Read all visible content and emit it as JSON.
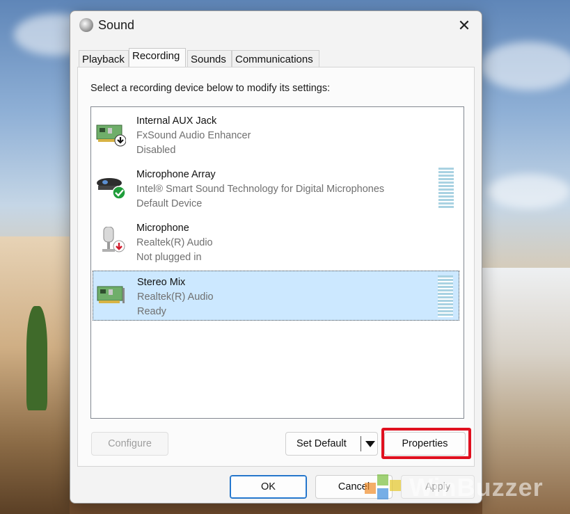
{
  "window": {
    "title": "Sound",
    "icon": "speaker-icon",
    "close_glyph": "✕"
  },
  "tabs": [
    {
      "label": "Playback"
    },
    {
      "label": "Recording",
      "active": true
    },
    {
      "label": "Sounds"
    },
    {
      "label": "Communications"
    }
  ],
  "instruction": "Select a recording device below to modify its settings:",
  "devices": [
    {
      "name": "Internal AUX Jack",
      "subtitle": "FxSound Audio Enhancer",
      "status": "Disabled",
      "icon": "sound-card-icon",
      "badge": "down-arrow-badge"
    },
    {
      "name": "Microphone Array",
      "subtitle": "Intel® Smart Sound Technology for Digital Microphones",
      "status": "Default Device",
      "icon": "webcam-microphone-icon",
      "badge": "green-check-badge"
    },
    {
      "name": "Microphone",
      "subtitle": "Realtek(R) Audio",
      "status": "Not plugged in",
      "icon": "microphone-icon",
      "badge": "red-down-arrow-badge"
    },
    {
      "name": "Stereo Mix",
      "subtitle": "Realtek(R) Audio",
      "status": "Ready",
      "icon": "sound-card-icon",
      "selected": true
    }
  ],
  "buttons": {
    "configure": "Configure",
    "set_default": "Set Default",
    "properties": "Properties",
    "ok": "OK",
    "cancel": "Cancel",
    "apply": "Apply"
  },
  "watermark": {
    "text": "WinBuzzer"
  },
  "colors": {
    "selection": "#cce8ff",
    "highlight_box": "#e0101f",
    "primary_border": "#1f6fc2"
  }
}
